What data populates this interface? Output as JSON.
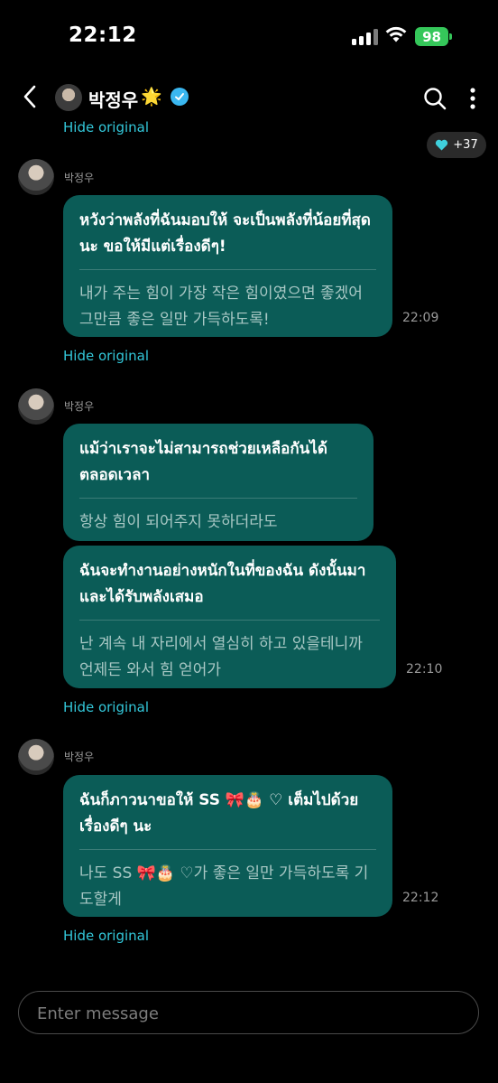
{
  "status": {
    "time": "22:12",
    "battery": "98"
  },
  "header": {
    "name": "박정우",
    "star": "🌟"
  },
  "top_hide_label": "Hide original",
  "reaction": {
    "count": "+37"
  },
  "messages": [
    {
      "sender": "박정우",
      "original": "หวังว่าพลังที่ฉันมอบให้ จะเป็นพลังที่น้อยที่สุดนะ ขอให้มีแต่เรื่องดีๆ!",
      "translation": "내가 주는 힘이 가장 작은 힘이였으면 좋겠어 그만큼 좋은 일만 가득하도록!",
      "time": "22:09",
      "hide_label": "Hide original"
    },
    {
      "sender": "박정우",
      "original": "แม้ว่าเราจะไม่สามารถช่วยเหลือกันได้ตลอดเวลา",
      "translation": "항상 힘이 되어주지 못하더라도"
    },
    {
      "original": "ฉันจะทำงานอย่างหนักในที่ของฉัน ดังนั้นมาและได้รับพลังเสมอ",
      "translation": "난 계속 내 자리에서 열심히 하고 있을테니까 언제든 와서 힘 얻어가",
      "time": "22:10",
      "hide_label": "Hide original"
    },
    {
      "sender": "박정우",
      "original": "ฉันก็ภาวนาขอให้ SS 🎀🎂 ♡ เต็มไปด้วยเรื่องดีๆ นะ",
      "translation": "나도 SS 🎀🎂 ♡가 좋은 일만 가득하도록 기도할게",
      "time": "22:12",
      "hide_label": "Hide original"
    }
  ],
  "input": {
    "placeholder": "Enter message"
  }
}
